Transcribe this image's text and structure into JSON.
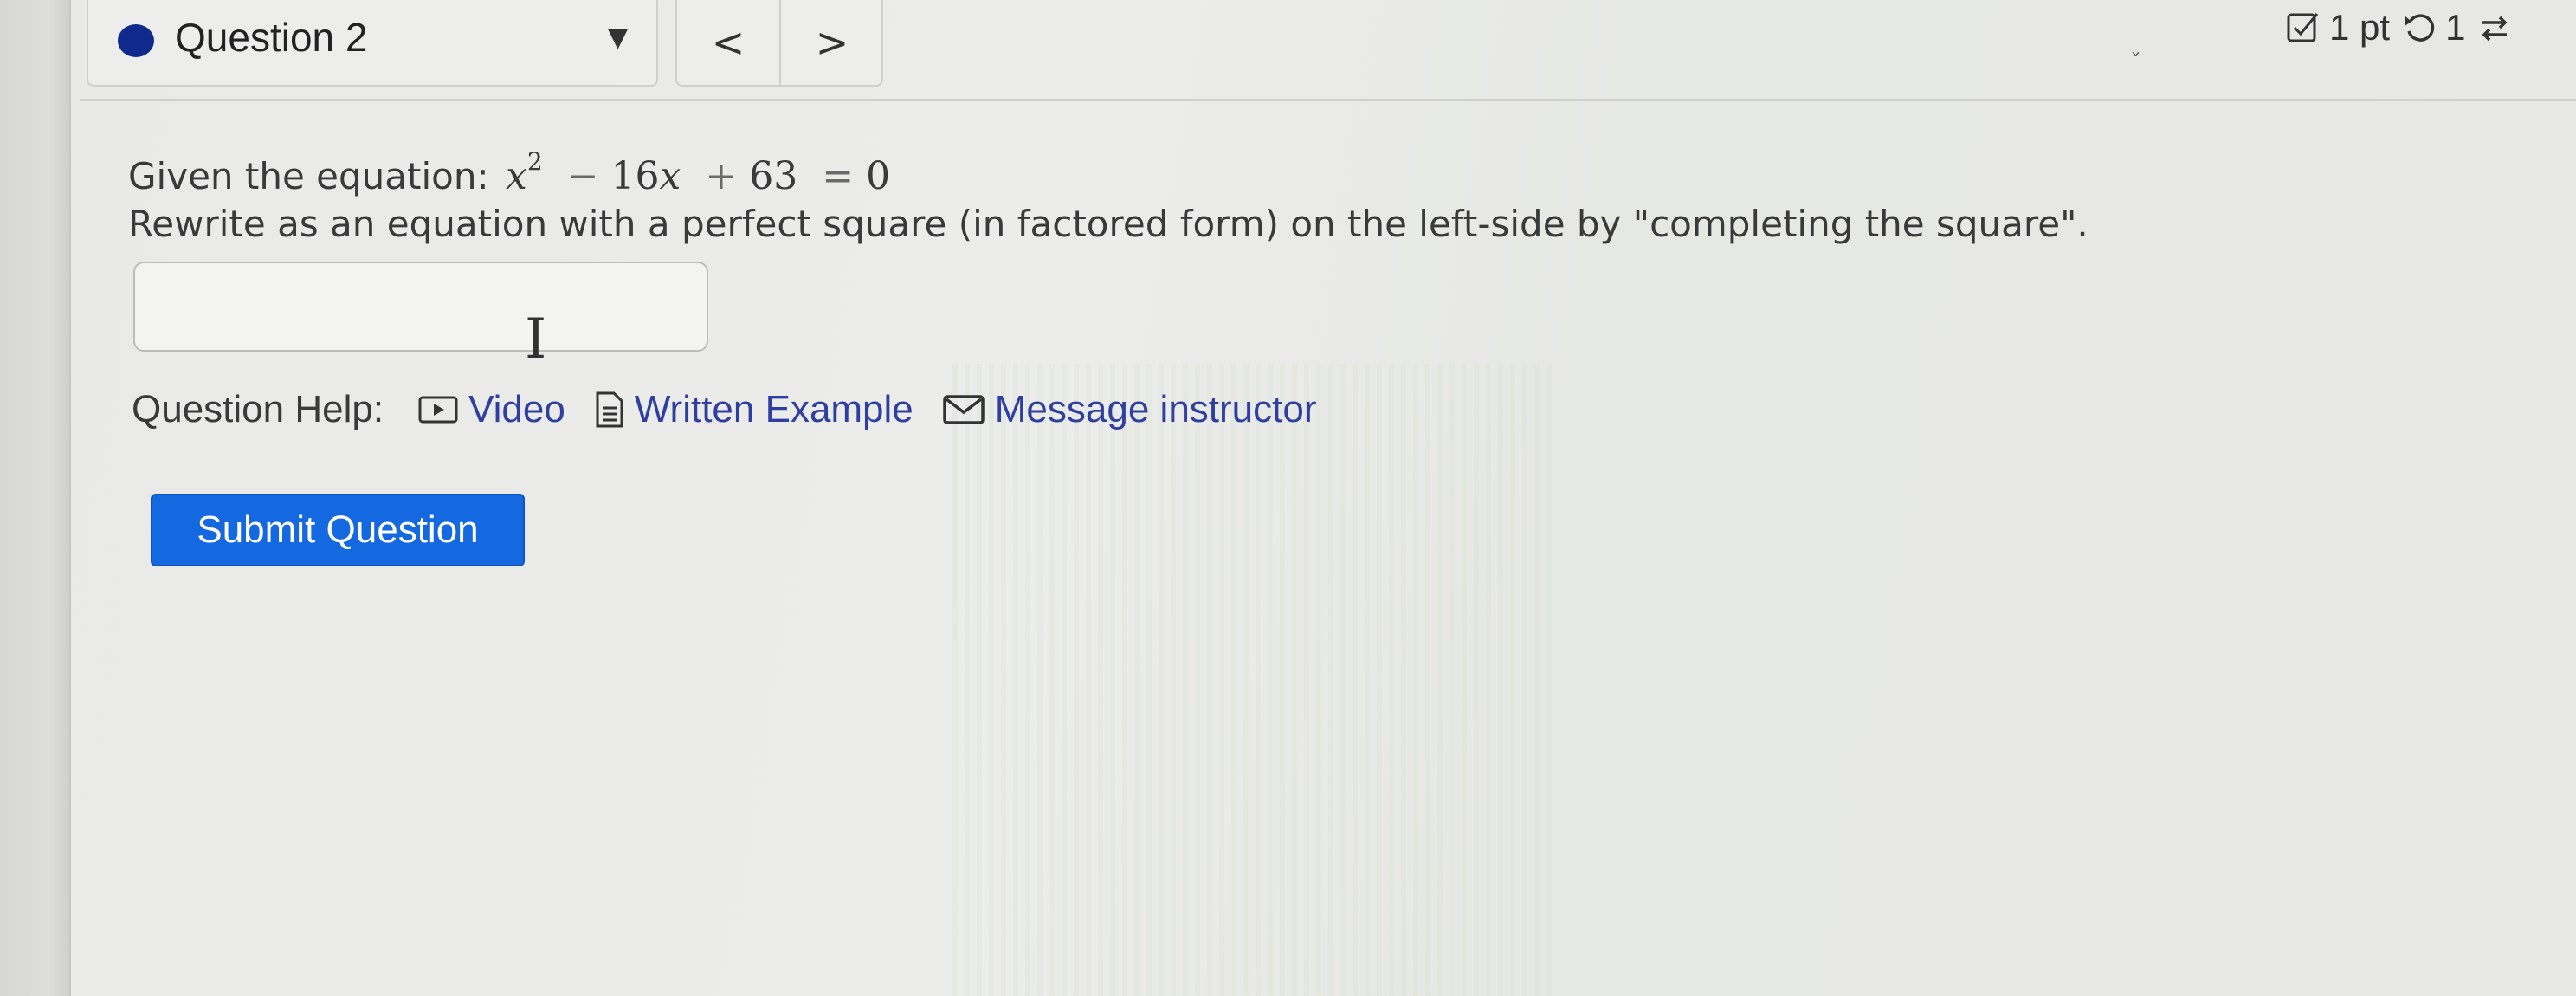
{
  "header": {
    "question_label": "Question 2",
    "caret": "▼",
    "prev_label": "<",
    "next_label": ">",
    "points": "1 pt",
    "retries": "1"
  },
  "question": {
    "prompt_prefix": "Given the equation:",
    "equation": {
      "var_x": "x",
      "exponent": "2",
      "minus": "−",
      "coef_16": "16",
      "plus": "+",
      "const_63": "63",
      "equals": "=",
      "zero": "0"
    },
    "instruction": "Rewrite as an equation with a perfect square (in factored form) on the left-side by \"completing the square\".",
    "answer_value": ""
  },
  "help": {
    "label": "Question Help:",
    "video": "Video",
    "written_example": "Written Example",
    "message_instructor": "Message instructor"
  },
  "submit": {
    "label": "Submit Question"
  },
  "colors": {
    "accent": "#1468e0",
    "link": "#2f3f9f",
    "question_dot": "#0f2a8c"
  }
}
